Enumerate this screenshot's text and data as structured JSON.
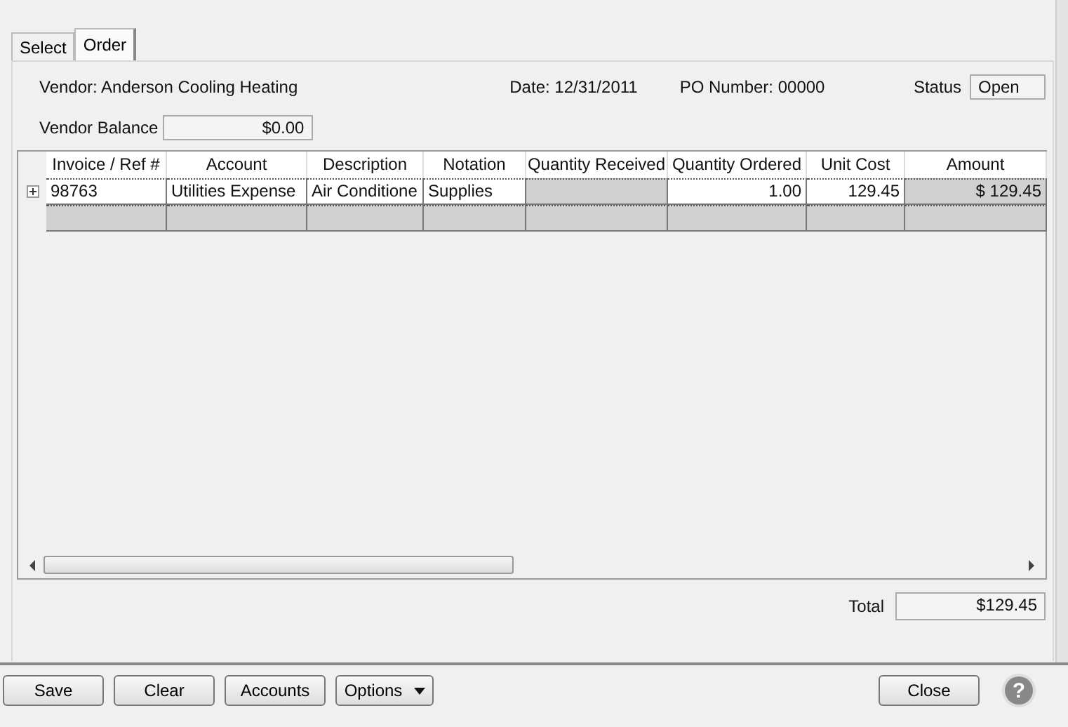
{
  "tabs": [
    {
      "label": "Select",
      "selected": false
    },
    {
      "label": "Order",
      "selected": true
    }
  ],
  "header": {
    "vendor": "Vendor:  Anderson Cooling  Heating",
    "date": "Date:  12/31/2011",
    "po_number": "PO Number:  00000",
    "status_label": "Status",
    "status_value": "Open",
    "vendor_balance_label": "Vendor Balance",
    "vendor_balance": "$0.00"
  },
  "table": {
    "columns": [
      {
        "label": "Invoice / Ref #"
      },
      {
        "label": "Account"
      },
      {
        "label": "Description"
      },
      {
        "label": "Notation"
      },
      {
        "label": "Quantity Received"
      },
      {
        "label": "Quantity Ordered"
      },
      {
        "label": "Unit Cost"
      },
      {
        "label": "Amount"
      }
    ],
    "rows": [
      {
        "expanded": false,
        "cells": [
          {
            "text": "98763",
            "readonly": false
          },
          {
            "text": "Utilities Expense",
            "readonly": false
          },
          {
            "text": "Air Conditione",
            "readonly": false
          },
          {
            "text": "Supplies",
            "readonly": false
          },
          {
            "readonly": true
          },
          {
            "text": "1.00",
            "readonly": false
          },
          {
            "text": "129.45",
            "readonly": false
          },
          {
            "text": "$ 129.45",
            "readonly": true
          }
        ]
      }
    ],
    "new_row": true
  },
  "total": {
    "label": "Total",
    "value": "$129.45"
  },
  "buttons": [
    {
      "label": "Save",
      "kind": "plain"
    },
    {
      "label": "Clear",
      "kind": "plain"
    },
    {
      "label": "Accounts",
      "kind": "plain"
    },
    {
      "label": "Options",
      "kind": "dropdown"
    }
  ],
  "close_button": "Close",
  "help_icon": "?"
}
